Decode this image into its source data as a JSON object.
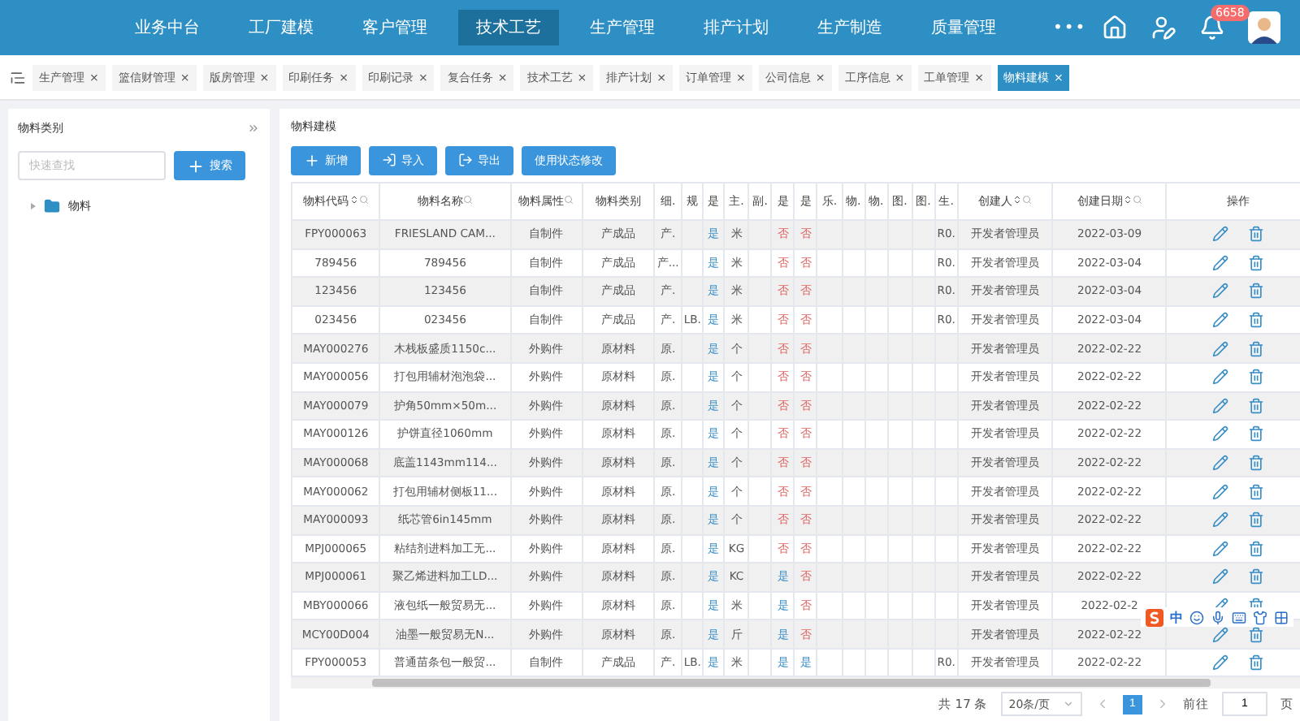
{
  "nav": {
    "items": [
      {
        "label": "业务中台",
        "selected": false
      },
      {
        "label": "工厂建模",
        "selected": false
      },
      {
        "label": "客户管理",
        "selected": false
      },
      {
        "label": "技术工艺",
        "selected": true
      },
      {
        "label": "生产管理",
        "selected": false
      },
      {
        "label": "排产计划",
        "selected": false
      },
      {
        "label": "生产制造",
        "selected": false
      },
      {
        "label": "质量管理",
        "selected": false
      }
    ],
    "more": "•••",
    "badge": "6658"
  },
  "tabs": [
    {
      "label": "生产管理",
      "selected": false,
      "close": "×"
    },
    {
      "label": "篮信财管理",
      "selected": false,
      "close": "×"
    },
    {
      "label": "版房管理",
      "selected": false,
      "close": "×"
    },
    {
      "label": "印刷任务",
      "selected": false,
      "close": "×"
    },
    {
      "label": "印刷记录",
      "selected": false,
      "close": "×"
    },
    {
      "label": "复合任务",
      "selected": false,
      "close": "×"
    },
    {
      "label": "技术工艺",
      "selected": false,
      "close": "×"
    },
    {
      "label": "排产计划",
      "selected": false,
      "close": "×"
    },
    {
      "label": "订单管理",
      "selected": false,
      "close": "×"
    },
    {
      "label": "公司信息",
      "selected": false,
      "close": "×"
    },
    {
      "label": "工序信息",
      "selected": false,
      "close": "×"
    },
    {
      "label": "工单管理",
      "selected": false,
      "close": "×"
    },
    {
      "label": "物料建模",
      "selected": true,
      "close": "×"
    }
  ],
  "sidebar": {
    "title": "物料类别",
    "search": {
      "placeholder": "快速查找"
    },
    "button": "搜索",
    "tree": [
      {
        "label": "物料",
        "expanded": false
      }
    ]
  },
  "main": {
    "title": "物料建模",
    "toolbar": [
      {
        "label": "新增",
        "kind": "add"
      },
      {
        "label": "导入",
        "kind": "import"
      },
      {
        "label": "导出",
        "kind": "export"
      },
      {
        "label": "使用状态修改",
        "kind": "plain"
      }
    ],
    "table": {
      "columns": [
        {
          "label": "物料代码",
          "kind": "text",
          "sortable": true,
          "searchable": true
        },
        {
          "label": "物料名称",
          "kind": "text",
          "sortable": false,
          "searchable": true
        },
        {
          "label": "物料属性",
          "kind": "text",
          "sortable": false,
          "searchable": true
        },
        {
          "label": "物料类别",
          "kind": "text",
          "sortable": false,
          "searchable": false
        },
        {
          "label": "细.",
          "kind": "narrow",
          "sortable": false,
          "searchable": false
        },
        {
          "label": "规",
          "kind": "narrow",
          "sortable": false,
          "searchable": false
        },
        {
          "label": "是",
          "kind": "flag",
          "sortable": false,
          "searchable": false
        },
        {
          "label": "主.",
          "kind": "narrow",
          "sortable": false,
          "searchable": false
        },
        {
          "label": "副.",
          "kind": "narrow",
          "sortable": false,
          "searchable": false
        },
        {
          "label": "是",
          "kind": "flag",
          "sortable": false,
          "searchable": false
        },
        {
          "label": "是",
          "kind": "flag",
          "sortable": false,
          "searchable": false
        },
        {
          "label": "乐.",
          "kind": "narrow",
          "sortable": false,
          "searchable": false
        },
        {
          "label": "物.",
          "kind": "narrow",
          "sortable": false,
          "searchable": false
        },
        {
          "label": "物.",
          "kind": "narrow",
          "sortable": false,
          "searchable": false
        },
        {
          "label": "图.",
          "kind": "narrow",
          "sortable": false,
          "searchable": false
        },
        {
          "label": "图.",
          "kind": "narrow",
          "sortable": false,
          "searchable": false
        },
        {
          "label": "生.",
          "kind": "narrow",
          "sortable": false,
          "searchable": false
        },
        {
          "label": "创建人",
          "kind": "text",
          "sortable": true,
          "searchable": true
        },
        {
          "label": "创建日期",
          "kind": "text",
          "sortable": true,
          "searchable": true
        },
        {
          "label": "操作",
          "kind": "actions",
          "sortable": false,
          "searchable": false
        }
      ],
      "rows": [
        {
          "cells": [
            "FPY000063",
            "FRIESLAND CAM...",
            "自制件",
            "产成品",
            "产.",
            null,
            {
              "text": "是",
              "yes": true
            },
            "米",
            null,
            {
              "text": "否",
              "yes": false
            },
            {
              "text": "否",
              "yes": false
            },
            null,
            null,
            null,
            null,
            null,
            "R0.",
            "开发者管理员",
            "2022-03-09"
          ]
        },
        {
          "cells": [
            "789456",
            "789456",
            "自制件",
            "产成品",
            "产...",
            null,
            {
              "text": "是",
              "yes": true
            },
            "米",
            null,
            {
              "text": "否",
              "yes": false
            },
            {
              "text": "否",
              "yes": false
            },
            null,
            null,
            null,
            null,
            null,
            "R0.",
            "开发者管理员",
            "2022-03-04"
          ]
        },
        {
          "cells": [
            "123456",
            "123456",
            "自制件",
            "产成品",
            "产.",
            null,
            {
              "text": "是",
              "yes": true
            },
            "米",
            null,
            {
              "text": "否",
              "yes": false
            },
            {
              "text": "否",
              "yes": false
            },
            null,
            null,
            null,
            null,
            null,
            "R0.",
            "开发者管理员",
            "2022-03-04"
          ]
        },
        {
          "cells": [
            "023456",
            "023456",
            "自制件",
            "产成品",
            "产.",
            "LB.",
            {
              "text": "是",
              "yes": true
            },
            "米",
            null,
            {
              "text": "否",
              "yes": false
            },
            {
              "text": "否",
              "yes": false
            },
            null,
            null,
            null,
            null,
            null,
            "R0.",
            "开发者管理员",
            "2022-03-04"
          ]
        },
        {
          "cells": [
            "MAY000276",
            "木栈板盛质1150c...",
            "外购件",
            "原材料",
            "原.",
            null,
            {
              "text": "是",
              "yes": true
            },
            "个",
            null,
            {
              "text": "否",
              "yes": false
            },
            {
              "text": "否",
              "yes": false
            },
            null,
            null,
            null,
            null,
            null,
            null,
            "开发者管理员",
            "2022-02-22"
          ]
        },
        {
          "cells": [
            "MAY000056",
            "打包用辅材泡泡袋...",
            "外购件",
            "原材料",
            "原.",
            null,
            {
              "text": "是",
              "yes": true
            },
            "个",
            null,
            {
              "text": "否",
              "yes": false
            },
            {
              "text": "否",
              "yes": false
            },
            null,
            null,
            null,
            null,
            null,
            null,
            "开发者管理员",
            "2022-02-22"
          ]
        },
        {
          "cells": [
            "MAY000079",
            "护角50mm×50m...",
            "外购件",
            "原材料",
            "原.",
            null,
            {
              "text": "是",
              "yes": true
            },
            "个",
            null,
            {
              "text": "否",
              "yes": false
            },
            {
              "text": "否",
              "yes": false
            },
            null,
            null,
            null,
            null,
            null,
            null,
            "开发者管理员",
            "2022-02-22"
          ]
        },
        {
          "cells": [
            "MAY000126",
            "护饼直径1060mm",
            "外购件",
            "原材料",
            "原.",
            null,
            {
              "text": "是",
              "yes": true
            },
            "个",
            null,
            {
              "text": "否",
              "yes": false
            },
            {
              "text": "否",
              "yes": false
            },
            null,
            null,
            null,
            null,
            null,
            null,
            "开发者管理员",
            "2022-02-22"
          ]
        },
        {
          "cells": [
            "MAY000068",
            "底盖1143mm114...",
            "外购件",
            "原材料",
            "原.",
            null,
            {
              "text": "是",
              "yes": true
            },
            "个",
            null,
            {
              "text": "否",
              "yes": false
            },
            {
              "text": "否",
              "yes": false
            },
            null,
            null,
            null,
            null,
            null,
            null,
            "开发者管理员",
            "2022-02-22"
          ]
        },
        {
          "cells": [
            "MAY000062",
            "打包用辅材侧板11...",
            "外购件",
            "原材料",
            "原.",
            null,
            {
              "text": "是",
              "yes": true
            },
            "个",
            null,
            {
              "text": "否",
              "yes": false
            },
            {
              "text": "否",
              "yes": false
            },
            null,
            null,
            null,
            null,
            null,
            null,
            "开发者管理员",
            "2022-02-22"
          ]
        },
        {
          "cells": [
            "MAY000093",
            "纸芯管6in145mm",
            "外购件",
            "原材料",
            "原.",
            null,
            {
              "text": "是",
              "yes": true
            },
            "个",
            null,
            {
              "text": "否",
              "yes": false
            },
            {
              "text": "否",
              "yes": false
            },
            null,
            null,
            null,
            null,
            null,
            null,
            "开发者管理员",
            "2022-02-22"
          ]
        },
        {
          "cells": [
            "MPJ000065",
            "粘结剂进料加工无...",
            "外购件",
            "原材料",
            "原.",
            null,
            {
              "text": "是",
              "yes": true
            },
            "KG",
            null,
            {
              "text": "否",
              "yes": false
            },
            {
              "text": "否",
              "yes": false
            },
            null,
            null,
            null,
            null,
            null,
            null,
            "开发者管理员",
            "2022-02-22"
          ]
        },
        {
          "cells": [
            "MPJ000061",
            "聚乙烯进料加工LD...",
            "外购件",
            "原材料",
            "原.",
            null,
            {
              "text": "是",
              "yes": true
            },
            "KC",
            null,
            {
              "text": "是",
              "yes": true
            },
            {
              "text": "否",
              "yes": false
            },
            null,
            null,
            null,
            null,
            null,
            null,
            "开发者管理员",
            "2022-02-22"
          ]
        },
        {
          "cells": [
            "MBY000066",
            "液包纸一般贸易无...",
            "外购件",
            "原材料",
            "原.",
            null,
            {
              "text": "是",
              "yes": true
            },
            "米",
            null,
            {
              "text": "是",
              "yes": true
            },
            {
              "text": "否",
              "yes": false
            },
            null,
            null,
            null,
            null,
            null,
            null,
            "开发者管理员",
            "2022-02-2"
          ]
        },
        {
          "cells": [
            "MCY00D004",
            "油墨一般贸易无N...",
            "外购件",
            "原材料",
            "原.",
            null,
            {
              "text": "是",
              "yes": true
            },
            "斤",
            null,
            {
              "text": "是",
              "yes": true
            },
            {
              "text": "否",
              "yes": false
            },
            null,
            null,
            null,
            null,
            null,
            null,
            "开发者管理员",
            "2022-02-22"
          ]
        },
        {
          "cells": [
            "FPY000053",
            "普通苗条包一般贸...",
            "自制件",
            "产成品",
            "产.",
            "LB.",
            {
              "text": "是",
              "yes": true
            },
            "米",
            null,
            {
              "text": "是",
              "yes": true
            },
            {
              "text": "是",
              "yes": true
            },
            null,
            null,
            null,
            null,
            null,
            "R0.",
            "开发者管理员",
            "2022-02-22"
          ]
        }
      ]
    },
    "pagination": {
      "total": "共 17 条",
      "page_size": "20条/页",
      "pages": [
        {
          "label": "1",
          "selected": true
        }
      ],
      "goto_label": "前往",
      "goto_value": "1",
      "page_suffix": "页"
    }
  },
  "ime": {
    "label": "中"
  }
}
